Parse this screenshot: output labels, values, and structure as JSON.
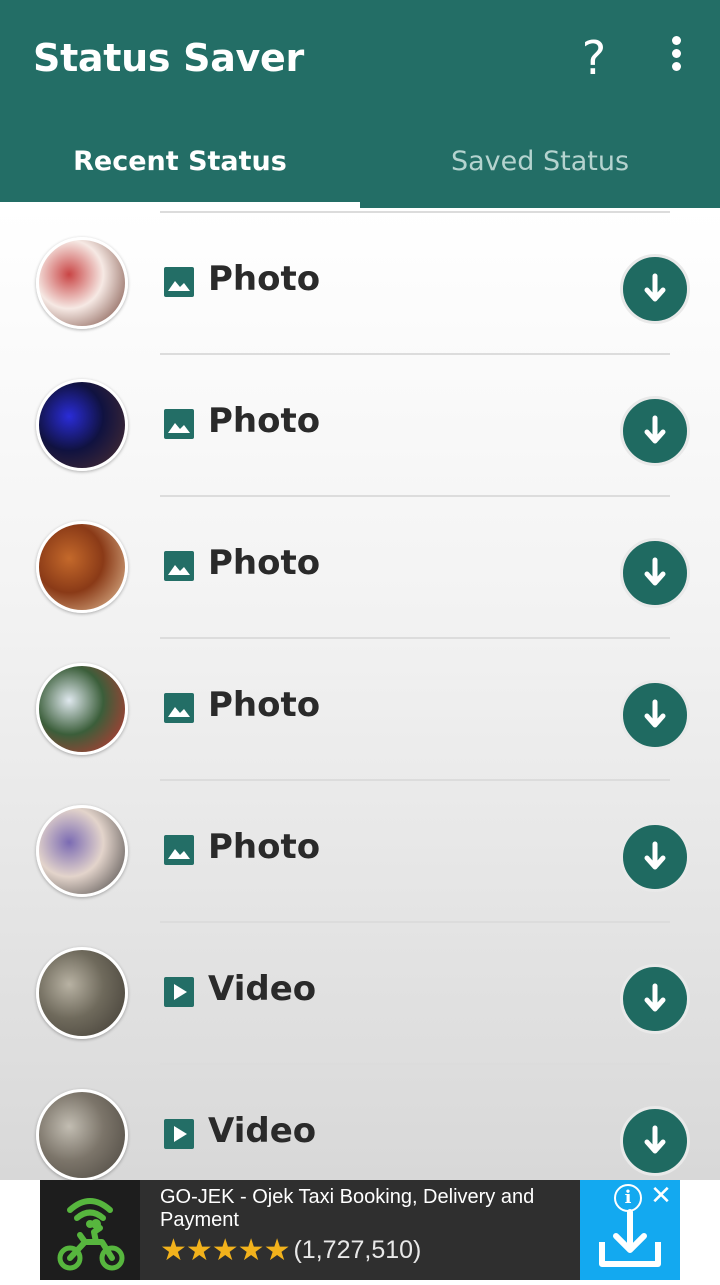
{
  "app": {
    "title": "Status Saver",
    "help_glyph": "?",
    "accent_color": "#236e66"
  },
  "tabs": [
    {
      "label": "Recent Status",
      "active": true
    },
    {
      "label": "Saved Status",
      "active": false
    }
  ],
  "statuses": [
    {
      "type": "photo",
      "label": "Photo",
      "thumb_colors": [
        "#f6e9e4",
        "#c94545",
        "#6b3a2e"
      ]
    },
    {
      "type": "photo",
      "label": "Photo",
      "thumb_colors": [
        "#101240",
        "#2a2cd8",
        "#503030"
      ]
    },
    {
      "type": "photo",
      "label": "Photo",
      "thumb_colors": [
        "#8a3a17",
        "#c4692b",
        "#e9c7a0"
      ]
    },
    {
      "type": "photo",
      "label": "Photo",
      "thumb_colors": [
        "#3b5e3a",
        "#dfe8ee",
        "#d23232"
      ]
    },
    {
      "type": "photo",
      "label": "Photo",
      "thumb_colors": [
        "#e3d4cb",
        "#7b6bb3",
        "#3c3a3a"
      ]
    },
    {
      "type": "video",
      "label": "Video",
      "thumb_colors": [
        "#6f6a5c",
        "#b8b2a3",
        "#3f3a33"
      ]
    },
    {
      "type": "video",
      "label": "Video",
      "thumb_colors": [
        "#7c756a",
        "#c2bdb2",
        "#4a453e"
      ]
    }
  ],
  "ad": {
    "title": "GO-JEK - Ojek Taxi Booking, Delivery and Payment",
    "stars": "★★★★★",
    "rating_count": "(1,727,510)",
    "info_glyph": "i",
    "close_glyph": "✕",
    "brand_color": "#57b63e",
    "install_color": "#13a9f0"
  }
}
